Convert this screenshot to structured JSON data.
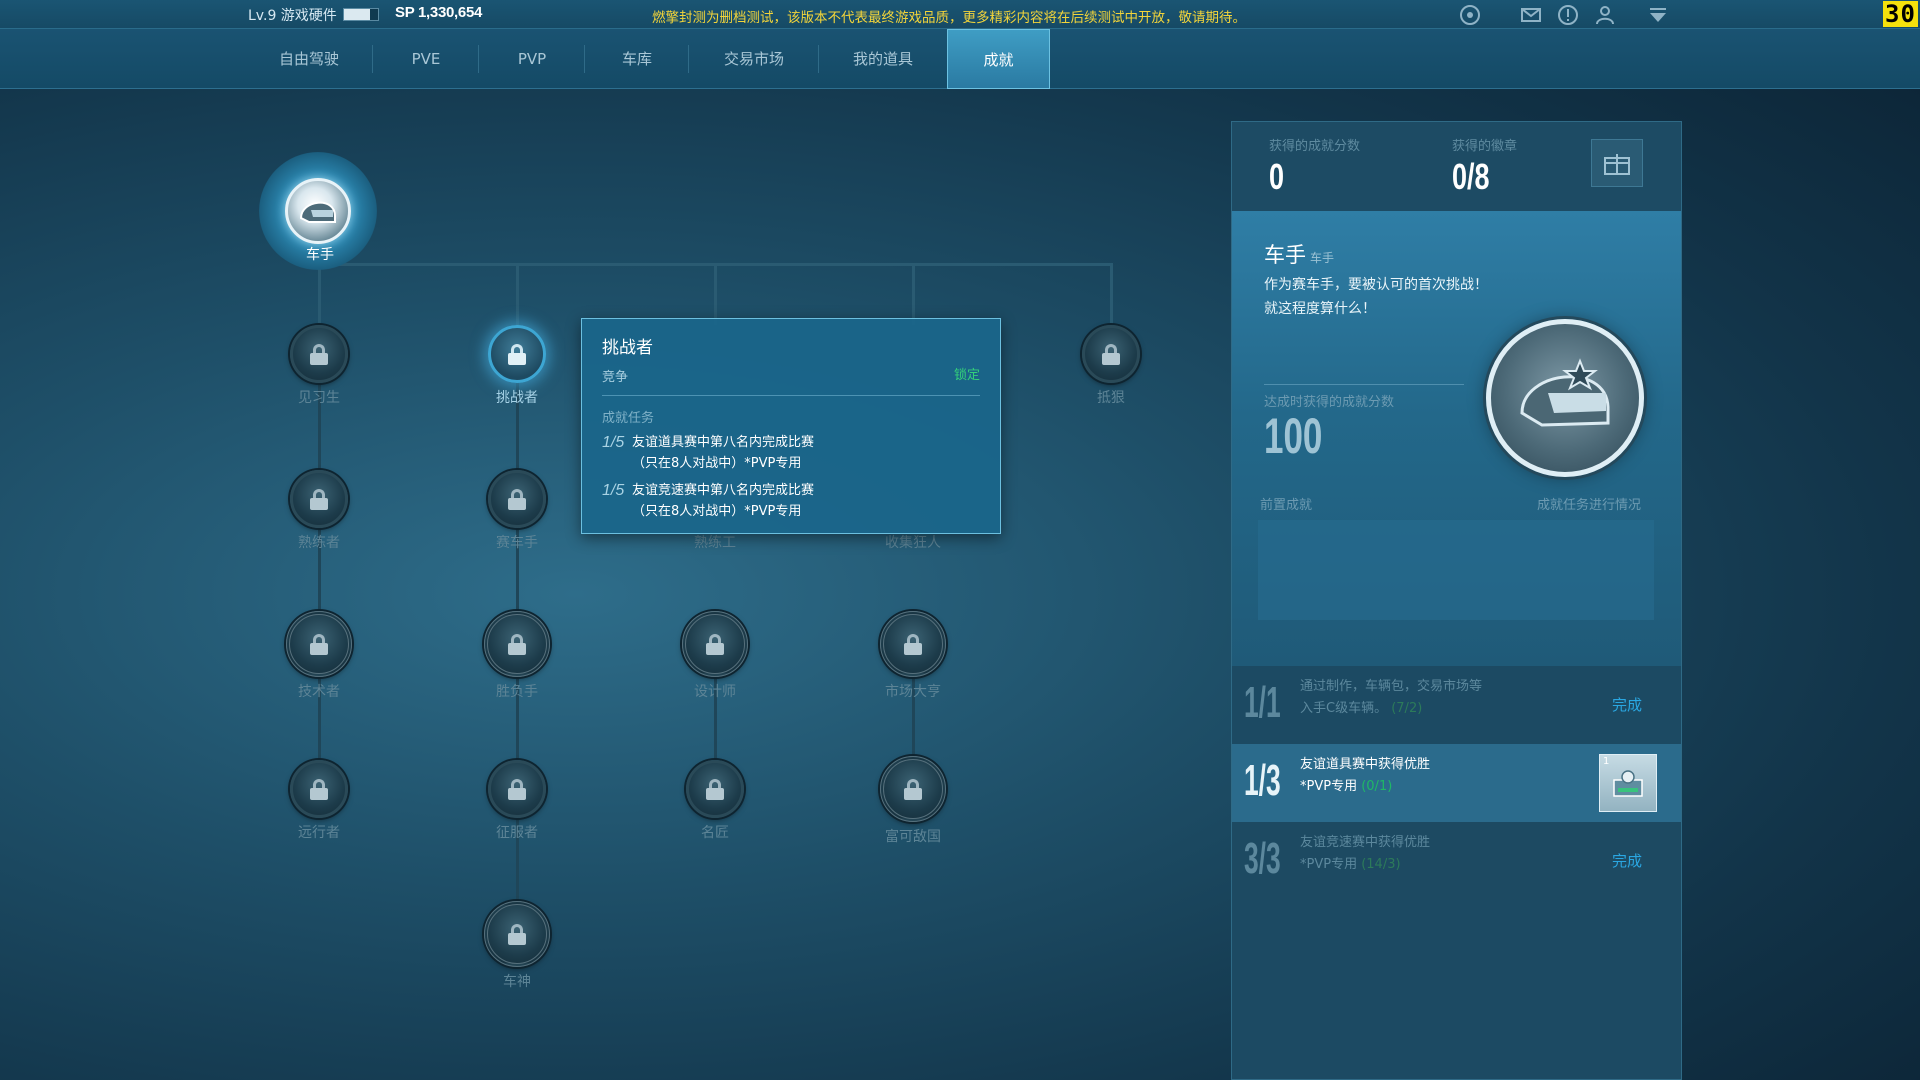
{
  "topbar": {
    "level_text": "Lv.9 游戏硬件",
    "level_progress": 0.75,
    "sp_text": "SP 1,330,654",
    "notice": "燃擎封测为删档测试，该版本不代表最终游戏品质，更多精彩内容将在后续测试中开放，敬请期待。",
    "fps": "30",
    "icons": [
      "globe-icon",
      "mail-icon",
      "alert-icon",
      "user-icon",
      "dropdown-icon"
    ]
  },
  "nav": {
    "tabs": [
      {
        "label": "自由驾驶"
      },
      {
        "label": "PVE"
      },
      {
        "label": "PVP"
      },
      {
        "label": "车库"
      },
      {
        "label": "交易市场"
      },
      {
        "label": "我的道具"
      },
      {
        "label": "成就"
      }
    ],
    "active": "成就"
  },
  "tree": {
    "root_label": "车手",
    "nodes": {
      "n1": "见习生",
      "n2": "熟练者",
      "n3": "技术者",
      "n4": "远行者",
      "n5": "挑战者",
      "n6": "赛车手",
      "n7": "胜负手",
      "n8": "征服者",
      "n9": "车神",
      "n10": "熟练工",
      "n11": "设计师",
      "n12": "名匠",
      "n13": "收集狂人",
      "n14": "市场大亨",
      "n15": "富可敌国",
      "n16": "抵狠"
    }
  },
  "tooltip": {
    "title": "挑战者",
    "category": "竞争",
    "status": "锁定",
    "section": "成就任务",
    "tasks": [
      {
        "progress": "1/5",
        "line1": "友谊道具赛中第八名内完成比赛",
        "line2": "（只在8人对战中）*PVP专用"
      },
      {
        "progress": "1/5",
        "line1": "友谊竞速赛中第八名内完成比赛",
        "line2": "（只在8人对战中）*PVP专用"
      }
    ]
  },
  "panel": {
    "score_label": "获得的成就分数",
    "score_value": "0",
    "medal_label": "获得的徽章",
    "medal_value": "0/8",
    "achievement": {
      "name": "车手",
      "subname": "车手",
      "desc1": "作为赛车手，要被认可的首次挑战！",
      "desc2": "就这程度算什么！",
      "points_label": "达成时获得的成就分数",
      "points_value": "100",
      "prereq_label": "前置成就",
      "progress_label": "成就任务进行情况"
    },
    "tasks": [
      {
        "progress": "1/1",
        "line1": "通过制作，车辆包，交易市场等",
        "line2": "入手C级车辆。",
        "count": "(7/2)",
        "done": "完成"
      },
      {
        "progress": "1/3",
        "line1": "友谊道具赛中获得优胜",
        "line2": "*PVP专用",
        "count": "(0/1)",
        "reward_qty": "1"
      },
      {
        "progress": "3/3",
        "line1": "友谊竞速赛中获得优胜",
        "line2": "*PVP专用",
        "count": "(14/3)",
        "done": "完成"
      }
    ]
  }
}
